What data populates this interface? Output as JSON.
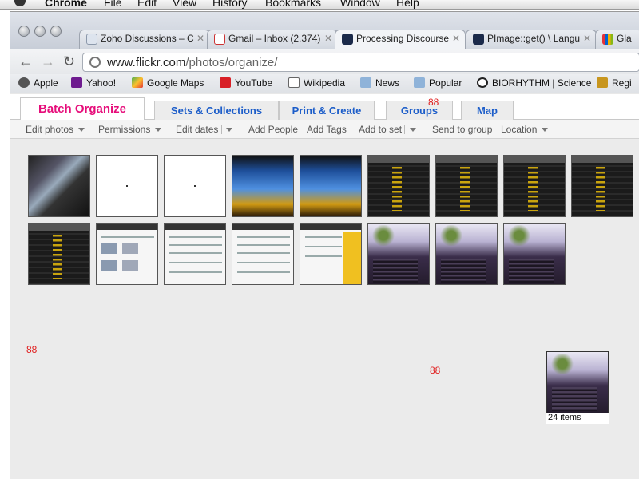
{
  "mac_menu": {
    "app": "Chrome",
    "items": [
      "File",
      "Edit",
      "View",
      "History",
      "Bookmarks",
      "Window",
      "Help"
    ]
  },
  "browser": {
    "tabs": [
      {
        "title": "Zoho Discussions – C",
        "icon": "zoho-favicon",
        "active": false
      },
      {
        "title": "Gmail – Inbox (2,374)",
        "icon": "gmail-favicon",
        "active": false
      },
      {
        "title": "Processing Discourse",
        "icon": "processing-favicon",
        "active": true
      },
      {
        "title": "PImage::get() \\ Langu",
        "icon": "processing-favicon",
        "active": false
      },
      {
        "title": "Gla",
        "icon": "ebay-favicon",
        "active": false
      }
    ],
    "url_host": "www.flickr.com",
    "url_path": "/photos/organize/",
    "bookmarks": [
      {
        "label": "Apple",
        "icon": "apple-icon"
      },
      {
        "label": "Yahoo!",
        "icon": "yahoo-icon"
      },
      {
        "label": "Google Maps",
        "icon": "google-maps-icon"
      },
      {
        "label": "YouTube",
        "icon": "youtube-icon"
      },
      {
        "label": "Wikipedia",
        "icon": "wikipedia-icon"
      },
      {
        "label": "News",
        "icon": "folder-icon"
      },
      {
        "label": "Popular",
        "icon": "folder-icon"
      },
      {
        "label": "BIORHYTHM | Science",
        "icon": "biorhythm-icon"
      },
      {
        "label": "Regi",
        "icon": "3d-icon"
      }
    ]
  },
  "organizr": {
    "tabs": [
      "Batch Organize",
      "Sets & Collections",
      "Print & Create",
      "Groups",
      "Map"
    ],
    "active_tab": "Batch Organize",
    "groups_overlay_number": "88",
    "actions": [
      {
        "label": "Edit photos",
        "dropdown": true
      },
      {
        "label": "Permissions",
        "dropdown": true
      },
      {
        "label": "Edit dates",
        "dropdown": true
      },
      {
        "label": "Add People",
        "dropdown": false
      },
      {
        "label": "Add Tags",
        "dropdown": false
      },
      {
        "label": "Add to set",
        "dropdown": true
      },
      {
        "label": "Send to group",
        "dropdown": false
      },
      {
        "label": "Location",
        "dropdown": true
      }
    ],
    "floating_numbers": [
      "88",
      "88"
    ],
    "stack_caption": "24 items"
  },
  "colors": {
    "flickr_pink": "#e60d7a",
    "flickr_blue": "#1c5dc9",
    "annotation_red": "#e02020"
  }
}
